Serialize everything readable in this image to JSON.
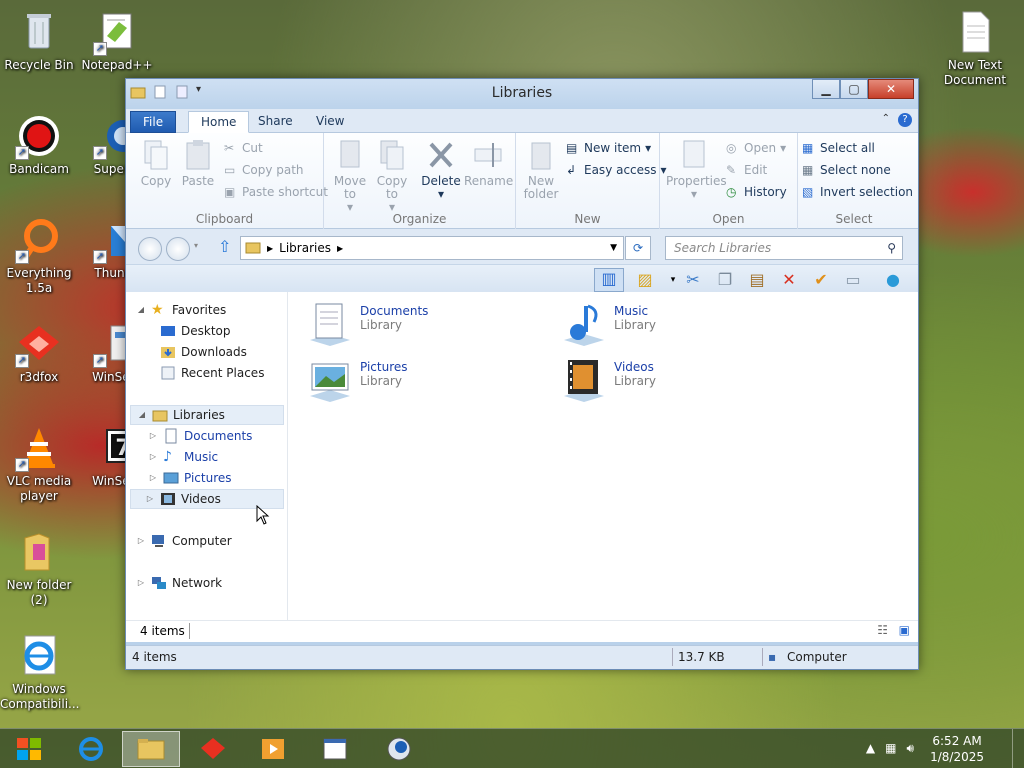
{
  "desktop": {
    "icons": [
      {
        "label": "Recycle Bin"
      },
      {
        "label": "Notepad++"
      },
      {
        "label": "Bandicam"
      },
      {
        "label": "Superm"
      },
      {
        "label": "Everything 1.5a"
      },
      {
        "label": "Thunde"
      },
      {
        "label": "r3dfox"
      },
      {
        "label": "WinSetu"
      },
      {
        "label": "VLC media player"
      },
      {
        "label": "WinSetu"
      },
      {
        "label": "New folder (2)"
      },
      {
        "label": "Windows Compatibili..."
      },
      {
        "label": "New Text Document"
      }
    ]
  },
  "window": {
    "title": "Libraries",
    "tabs": {
      "file": "File",
      "home": "Home",
      "share": "Share",
      "view": "View"
    },
    "ribbon": {
      "clipboard": {
        "label": "Clipboard",
        "copy": "Copy",
        "paste": "Paste",
        "cut": "Cut",
        "copy_path": "Copy path",
        "paste_shortcut": "Paste shortcut"
      },
      "organize": {
        "label": "Organize",
        "move_to": "Move to",
        "copy_to": "Copy to",
        "delete": "Delete",
        "rename": "Rename"
      },
      "new": {
        "label": "New",
        "new_folder": "New folder",
        "new_item": "New item",
        "easy_access": "Easy access"
      },
      "open": {
        "label": "Open",
        "properties": "Properties",
        "open": "Open",
        "edit": "Edit",
        "history": "History"
      },
      "select": {
        "label": "Select",
        "select_all": "Select all",
        "select_none": "Select none",
        "invert_selection": "Invert selection"
      }
    },
    "address": {
      "path": "Libraries",
      "search_placeholder": "Search Libraries"
    },
    "nav": {
      "favorites": "Favorites",
      "desktop": "Desktop",
      "downloads": "Downloads",
      "recent_places": "Recent Places",
      "libraries": "Libraries",
      "documents": "Documents",
      "music": "Music",
      "pictures": "Pictures",
      "videos": "Videos",
      "computer": "Computer",
      "network": "Network"
    },
    "items": [
      {
        "name": "Documents",
        "type": "Library"
      },
      {
        "name": "Music",
        "type": "Library"
      },
      {
        "name": "Pictures",
        "type": "Library"
      },
      {
        "name": "Videos",
        "type": "Library"
      }
    ],
    "details_count": "4 items",
    "status": {
      "count": "4 items",
      "size": "13.7 KB",
      "location": "Computer"
    }
  },
  "taskbar": {
    "time": "6:52 AM",
    "date": "1/8/2025"
  }
}
